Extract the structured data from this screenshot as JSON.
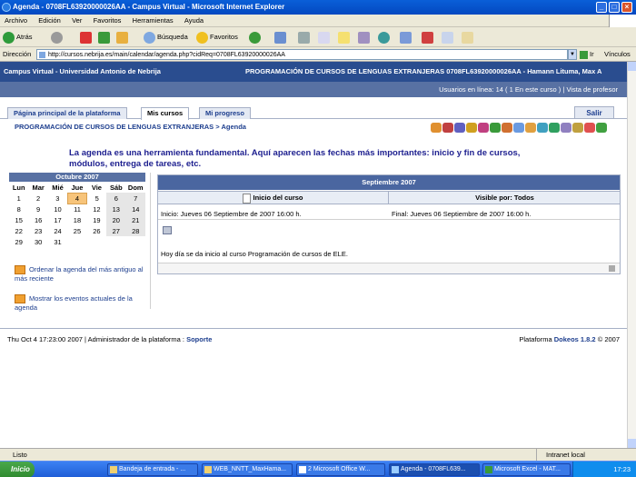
{
  "window": {
    "title": "Agenda - 0708FL63920000026AA - Campus Virtual - Microsoft Internet Explorer"
  },
  "menu": [
    "Archivo",
    "Edición",
    "Ver",
    "Favoritos",
    "Herramientas",
    "Ayuda"
  ],
  "toolbar": {
    "back": "Atrás",
    "search": "Búsqueda",
    "favorites": "Favoritos"
  },
  "address": {
    "label": "Dirección",
    "url": "http://cursos.nebrija.es/main/calendar/agenda.php?cidReq=0708FL63920000026AA",
    "go": "Ir",
    "links": "Vínculos"
  },
  "header": {
    "site": "Campus Virtual - Universidad Antonio de Nebrija",
    "course": "PROGRAMACIÓN DE CURSOS DE LENGUAS EXTRANJERAS 0708FL63920000026AA - Hamann Lituma, Max A",
    "online": "Usuarios en línea:  14  ( 1 En este curso )",
    "vista": "| Vista de profesor"
  },
  "tabs": [
    "Página principal de la plataforma",
    "Mis cursos",
    "Mi progreso"
  ],
  "logout": "Salir",
  "breadcrumb": "PROGRAMACIÓN DE CURSOS DE LENGUAS EXTRANJERAS > Agenda",
  "intro": "La agenda es una herramienta fundamental. Aquí aparecen las fechas más importantes: inicio y fin de cursos, módulos, entrega de tareas, etc.",
  "calendar": {
    "month": "Octubre 2007",
    "days": [
      "Lun",
      "Mar",
      "Mié",
      "Jue",
      "Vie",
      "Sáb",
      "Dom"
    ],
    "weeks": [
      [
        "1",
        "2",
        "3",
        "4",
        "5",
        "6",
        "7"
      ],
      [
        "8",
        "9",
        "10",
        "11",
        "12",
        "13",
        "14"
      ],
      [
        "15",
        "16",
        "17",
        "18",
        "19",
        "20",
        "21"
      ],
      [
        "22",
        "23",
        "24",
        "25",
        "26",
        "27",
        "28"
      ],
      [
        "29",
        "30",
        "31",
        "",
        "",
        "",
        ""
      ]
    ],
    "today": "4"
  },
  "actions": [
    "Ordenar la agenda del más antiguo al más reciente",
    "Mostrar los eventos actuales de la agenda"
  ],
  "agenda": {
    "month": "Septiembre 2007",
    "col1": "Inicio del curso",
    "col2": "Visible por: Todos",
    "start": "Inicio: Jueves 06 Septiembre de 2007   16:00 h.",
    "end": "Final: Jueves 06 Septiembre de 2007   16:00 h.",
    "text": "Hoy día se da inicio al curso Programación de cursos de ELE."
  },
  "footer": {
    "left": "Thu Oct 4 17:23:00 2007 | Administrador de la plataforma :",
    "support": "Soporte",
    "platform": "Plataforma",
    "dokeos": "Dokeos 1.8.2",
    "copy": "© 2007"
  },
  "status": {
    "text": "Listo",
    "zone": "Intranet local"
  },
  "taskbar": {
    "start": "Inicio",
    "tasks": [
      "Bandeja de entrada - ...",
      "WEB_NNTT_MaxHama...",
      "2 Microsoft Office W...",
      "Agenda - 0708FL639...",
      "Microsoft Excel - MAT..."
    ],
    "clock": "17:23"
  }
}
